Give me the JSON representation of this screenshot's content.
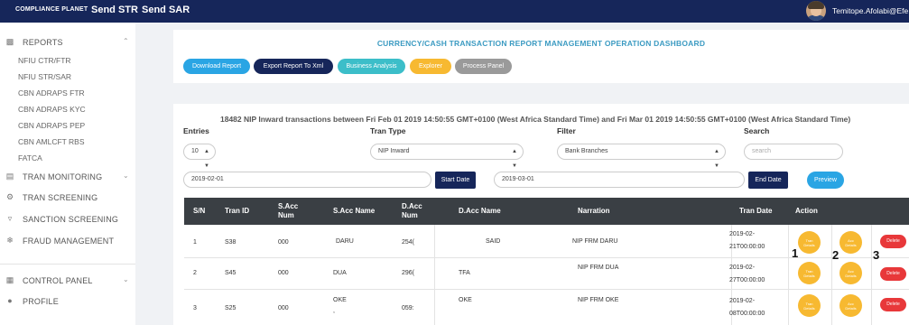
{
  "topbar": {
    "brand": "COMPLIANCE PLANET",
    "nav": [
      "Send STR",
      "Send SAR"
    ],
    "username": "Temitope.Afolabi@Efe"
  },
  "sidebar": {
    "reports_label": "REPORTS",
    "report_items": [
      "NFIU CTR/FTR",
      "NFIU STR/SAR",
      "CBN ADRAPS FTR",
      "CBN ADRAPS KYC",
      "CBN ADRAPS PEP",
      "CBN AMLCFT RBS",
      "FATCA"
    ],
    "tran_monitoring": "TRAN MONITORING",
    "tran_screening": "TRAN SCREENING",
    "sanction_screening": "SANCTION SCREENING",
    "fraud_management": "FRAUD MANAGEMENT",
    "control_panel": "CONTROL PANEL",
    "profile": "PROFILE"
  },
  "dashboard": {
    "title": "CURRENCY/CASH TRANSACTION REPORT MANAGEMENT OPERATION DASHBOARD",
    "buttons": {
      "download": "Download Report",
      "export_xml": "Export Report To Xml",
      "business": "Business Analysis",
      "explorer": "Explorer",
      "process": "Process Panel"
    }
  },
  "colors": {
    "navy": "#16265a",
    "download": "#2aa5e4",
    "business": "#3cbec9",
    "explorer": "#f7b931",
    "process": "#9a9a9a",
    "delete": "#e8383a"
  },
  "transactions": {
    "header": "18482 NIP Inward transactions between Fri Feb 01 2019 14:50:55 GMT+0100 (West Africa Standard Time) and Fri Mar 01 2019 14:50:55 GMT+0100 (West Africa Standard Time)",
    "filters": {
      "entries_label": "Entries",
      "entries_value": "10",
      "tran_type_label": "Tran Type",
      "tran_type_value": "NIP Inward",
      "filter_label": "Filter",
      "filter_value": "Bank Branches",
      "search_label": "Search",
      "search_placeholder": "search",
      "start_date_value": "2019-02-01",
      "start_date_btn": "Start Date",
      "end_date_value": "2019-03-01",
      "end_date_btn": "End Date",
      "preview_btn": "Preview"
    },
    "columns": [
      "S/N",
      "Tran ID",
      "S.Acc Num",
      "S.Acc Name",
      "D.Acc Num",
      "D.Acc Name",
      "Narration",
      "Tran Date",
      "Action"
    ],
    "rows": [
      {
        "sn": "1",
        "tran_id": "S38",
        "sacc_num": "000",
        "sacc_name": "DARU",
        "dacc_num": "254(",
        "dacc_name": "SAID",
        "narration": "NIP FRM DARU",
        "date1": "2019-02-",
        "date2": "21T00:00:00"
      },
      {
        "sn": "2",
        "tran_id": "S45",
        "sacc_num": "000",
        "sacc_name": "DUA",
        "dacc_num": "296(",
        "dacc_name": "TFA",
        "narration": "NIP FRM DUA",
        "date1": "2019-02-",
        "date2": "27T00:00:00"
      },
      {
        "sn": "3",
        "tran_id": "S25",
        "sacc_num": "000",
        "sacc_name": "OKE",
        "sacc_name2": ",",
        "dacc_num": "059:",
        "dacc_name": "OKE",
        "narration": "NIP FRM OKE",
        "date1": "2019-02-",
        "date2": "08T00:00:00"
      }
    ],
    "actions": {
      "tran_details_l1": "Tran",
      "tran_details_l2": "Details",
      "acc_details_l1": "Acc",
      "acc_details_l2": "Details",
      "delete": "Delete"
    },
    "annotations": [
      "1",
      "2",
      "3"
    ]
  }
}
